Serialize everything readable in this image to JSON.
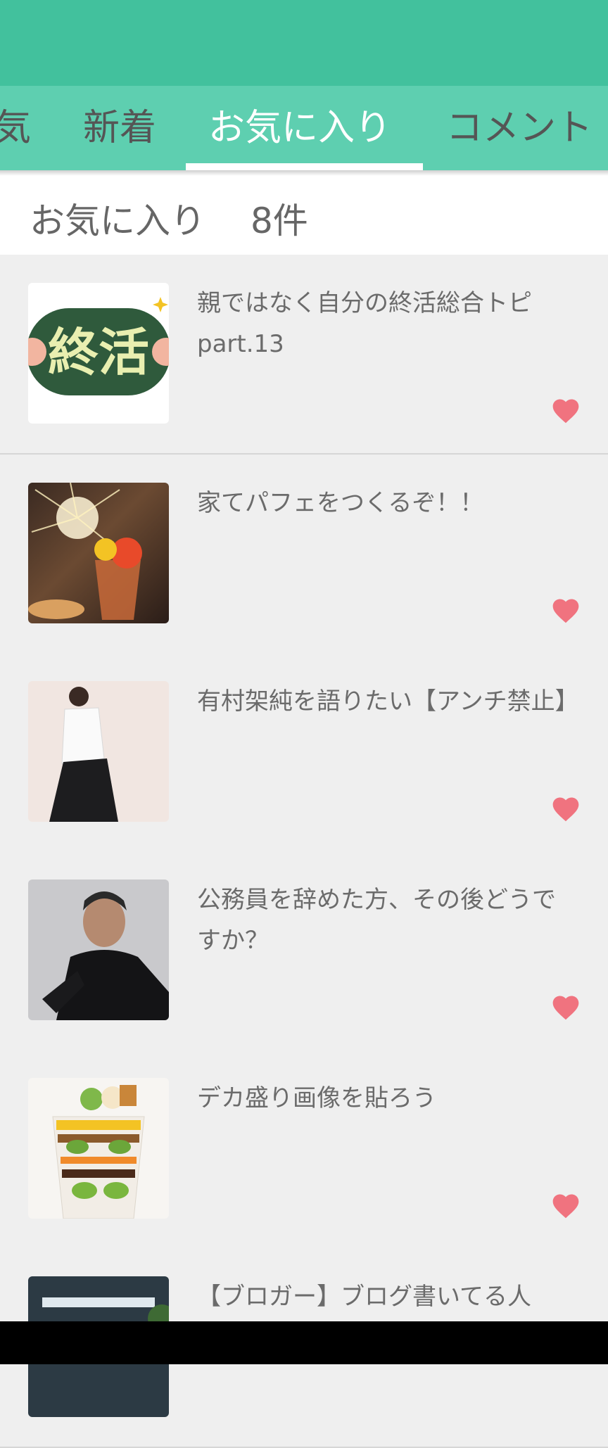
{
  "tabs": [
    {
      "label": "気"
    },
    {
      "label": "新着"
    },
    {
      "label": "お気に入り"
    },
    {
      "label": "コメント"
    }
  ],
  "header": {
    "title": "お気に入り",
    "count": "8件"
  },
  "items": [
    {
      "title": "親ではなく自分の終活総合トピpart.13",
      "thumb_text": "終活"
    },
    {
      "title": "家てパフェをつくるぞ！！"
    },
    {
      "title": "有村架純を語りたい【アンチ禁止】"
    },
    {
      "title": "公務員を辞めた方、その後どうですか？"
    },
    {
      "title": "デカ盛り画像を貼ろう"
    },
    {
      "title": "【ブロガー】ブログ書いてる人"
    }
  ],
  "colors": {
    "brand": "#42c19d",
    "tab_bar": "#5ecfb0",
    "heart": "#f0737f"
  },
  "icons": {
    "favorite": "heart-icon"
  }
}
